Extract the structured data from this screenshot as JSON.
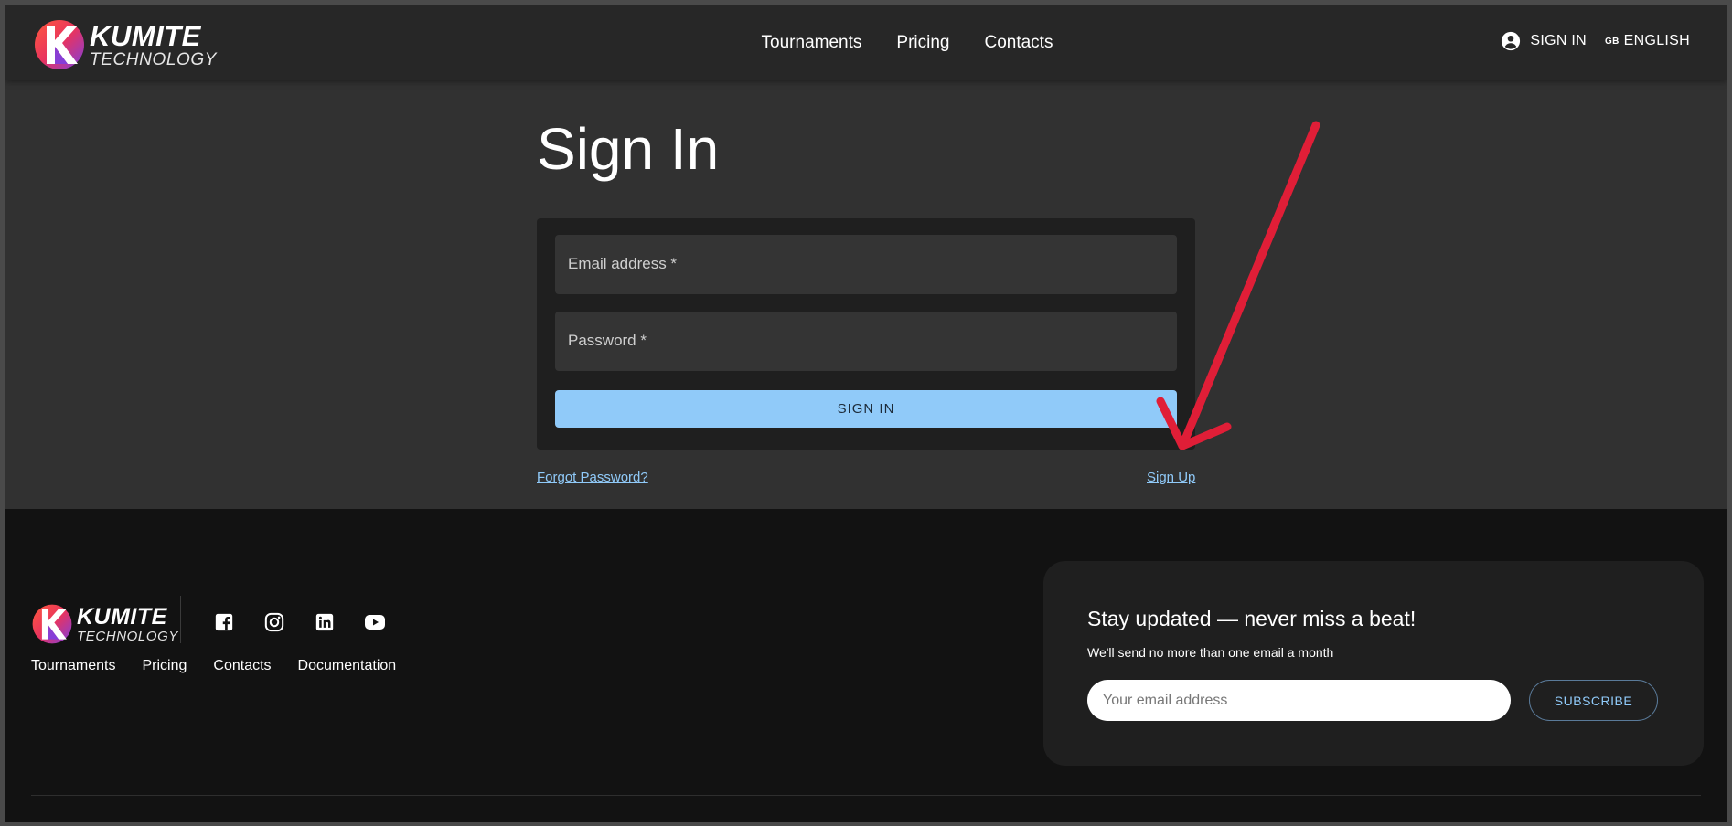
{
  "brand": {
    "name_line1": "KUMITE",
    "name_line2": "TECHNOLOGY"
  },
  "header": {
    "nav": [
      {
        "label": "Tournaments"
      },
      {
        "label": "Pricing"
      },
      {
        "label": "Contacts"
      }
    ],
    "sign_in_label": "SIGN IN",
    "language": {
      "flag_code": "GB",
      "label": "ENGLISH"
    }
  },
  "signin_form": {
    "title": "Sign In",
    "email_label": "Email address *",
    "password_label": "Password *",
    "submit_label": "SIGN IN",
    "forgot_label": "Forgot Password?",
    "signup_label": "Sign Up"
  },
  "annotation": {
    "arrow_color": "#e01e37"
  },
  "footer": {
    "social_icons": [
      "facebook-icon",
      "instagram-icon",
      "linkedin-icon",
      "youtube-icon"
    ],
    "links": [
      {
        "label": "Tournaments"
      },
      {
        "label": "Pricing"
      },
      {
        "label": "Contacts"
      },
      {
        "label": "Documentation"
      }
    ],
    "newsletter": {
      "title": "Stay updated — never miss a beat!",
      "subtitle": "We'll send no more than one email a month",
      "email_placeholder": "Your email address",
      "subscribe_label": "SUBSCRIBE"
    }
  },
  "colors": {
    "accent": "#90caf9",
    "header_bg": "#272727",
    "page_bg": "#313131",
    "footer_bg": "#121212",
    "card_bg": "#1f1f1f"
  }
}
